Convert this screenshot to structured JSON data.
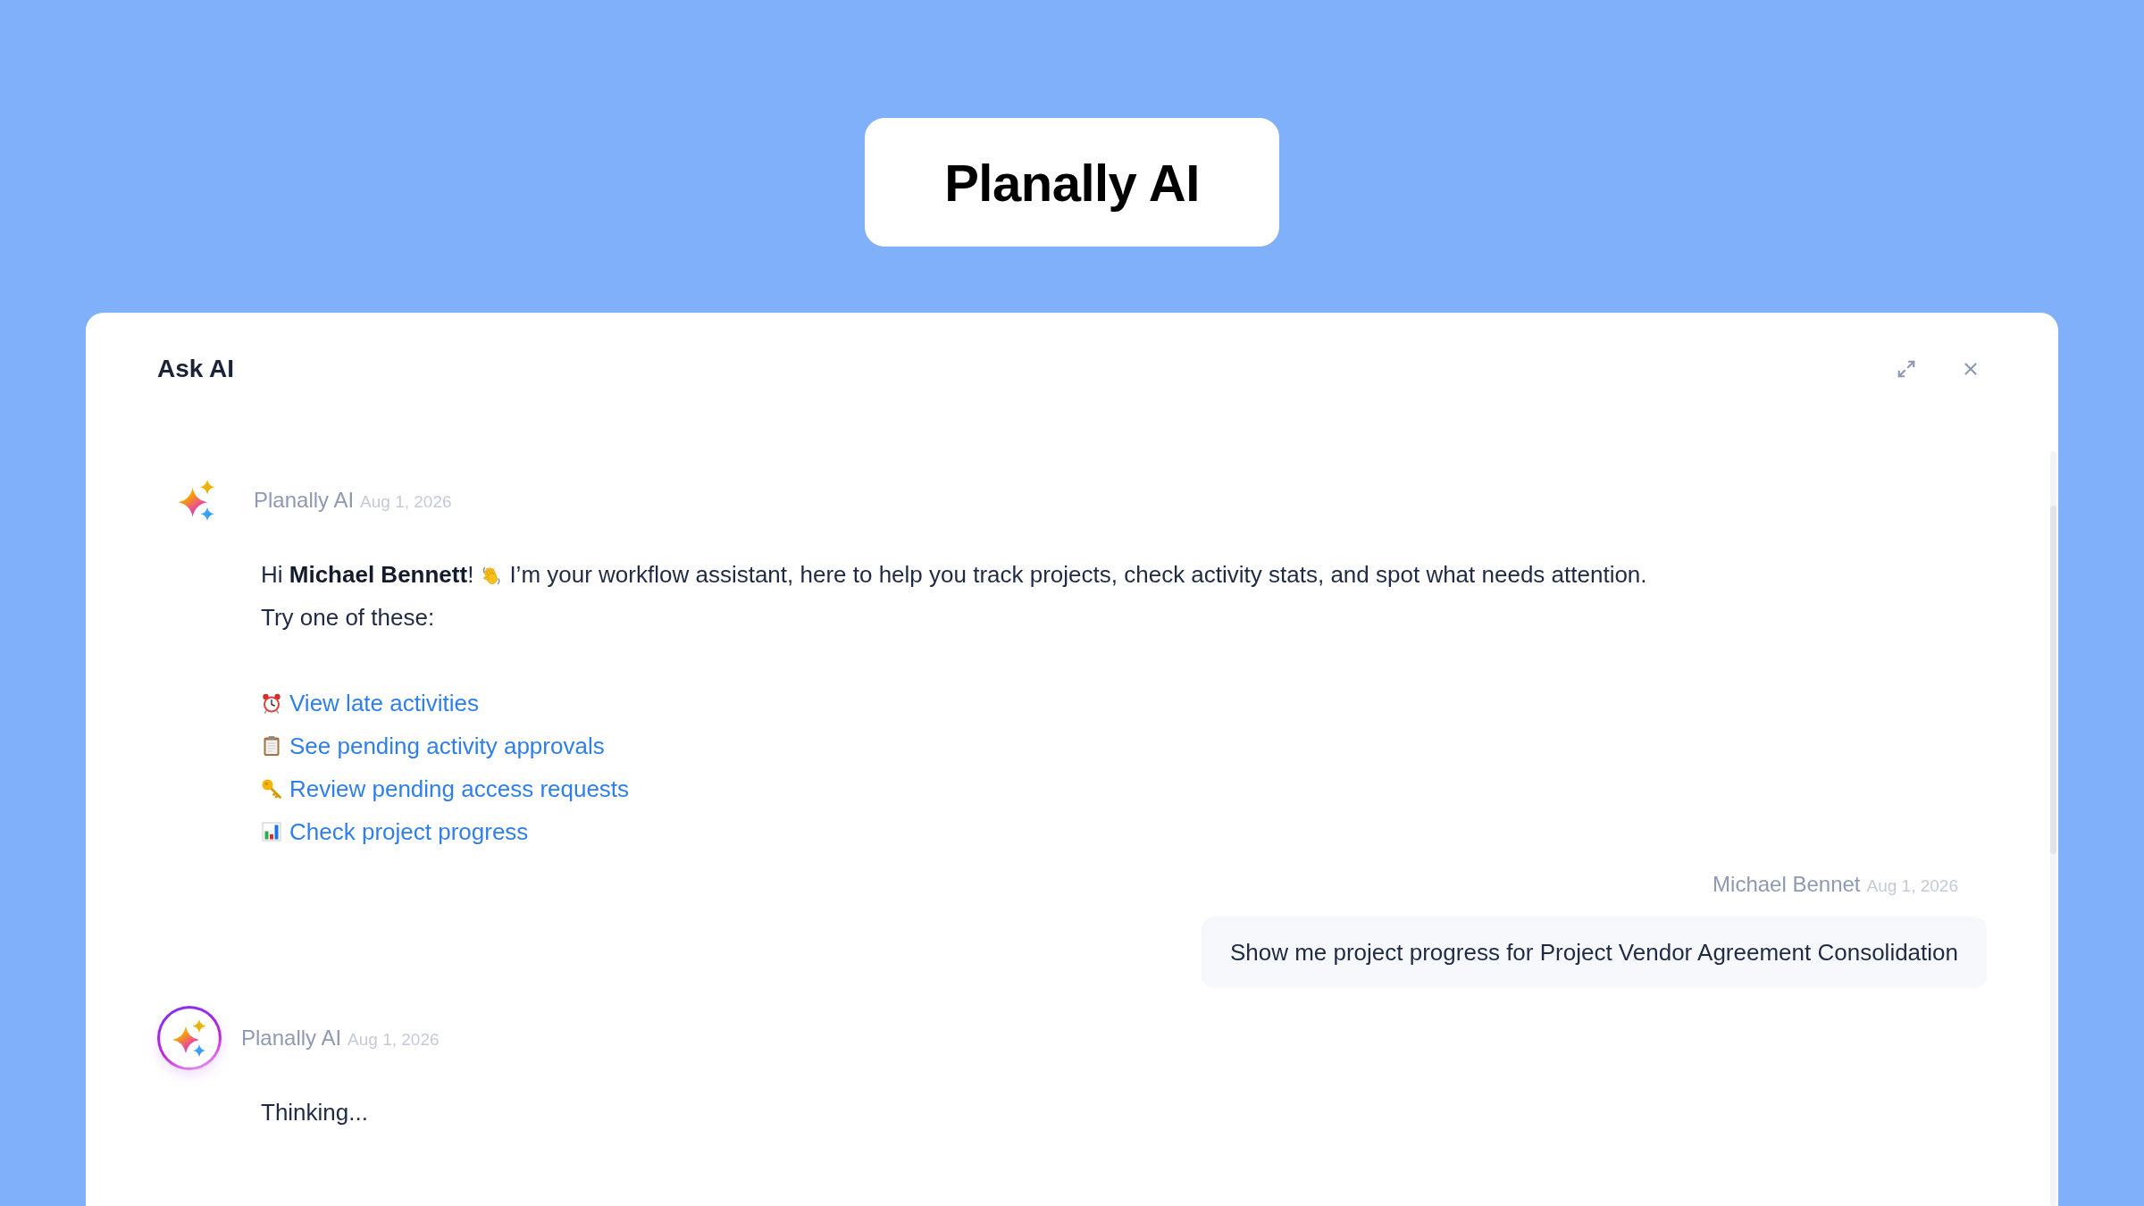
{
  "banner": {
    "title": "Planally AI"
  },
  "panel": {
    "title": "Ask AI"
  },
  "messages": [
    {
      "kind": "assistant",
      "sender": "Planally AI",
      "date": "Aug 1, 2026",
      "active": false,
      "greeting": "Hi **Michael Bennett**!",
      "intro": "I’m your workflow assistant, here to help you track projects, check activity stats, and spot what needs attention.",
      "prompt": "Try one of these:",
      "suggestions": [
        "View late activities",
        "See pending activity approvals",
        "Review pending access requests",
        "Check project progress"
      ]
    },
    {
      "kind": "user",
      "sender": "Michael Bennet",
      "date": "Aug 1, 2026",
      "text": "Show me project progress for Project Vendor Agreement Consolidation"
    },
    {
      "kind": "assistant",
      "sender": "Planally AI",
      "date": "Aug 1, 2026",
      "active": true,
      "text": "Thinking..."
    }
  ]
}
